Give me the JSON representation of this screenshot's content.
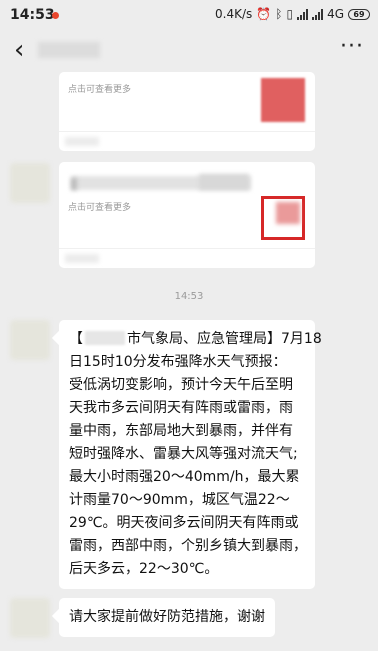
{
  "status_bar": {
    "time": "14:53",
    "network_speed": "0.4K/s",
    "network_type": "4G",
    "battery": "69"
  },
  "nav": {
    "back_glyph": "‹",
    "more_glyph": "···"
  },
  "cards": [
    {
      "hint": "点击可查看更多"
    },
    {
      "hint": "点击可查看更多"
    }
  ],
  "timestamp": "14:53",
  "message": {
    "lines": [
      "市气象局、应急管理局】7月18",
      "日15时10分发布强降水天气预报：",
      "受低涡切变影响，预计今天午后至明",
      "天我市多云间阴天有阵雨或雷雨，雨",
      "量中雨，东部局地大到暴雨，并伴有",
      "短时强降水、雷暴大风等强对流天气;",
      "最大小时雨强20～40mm/h，最大累",
      "计雨量70～90mm，城区气温22～",
      "29℃。明天夜间多云间阴天有阵雨或",
      "雷雨，西部中雨，个别乡镇大到暴雨，",
      "后天多云，22～30℃。"
    ],
    "bracket_open": "【"
  },
  "message2": {
    "text": "请大家提前做好防范措施，谢谢"
  },
  "icons": [
    "back-arrow-icon",
    "more-icon",
    "bluetooth-icon",
    "alarm-icon",
    "signal-icon",
    "battery-icon"
  ]
}
